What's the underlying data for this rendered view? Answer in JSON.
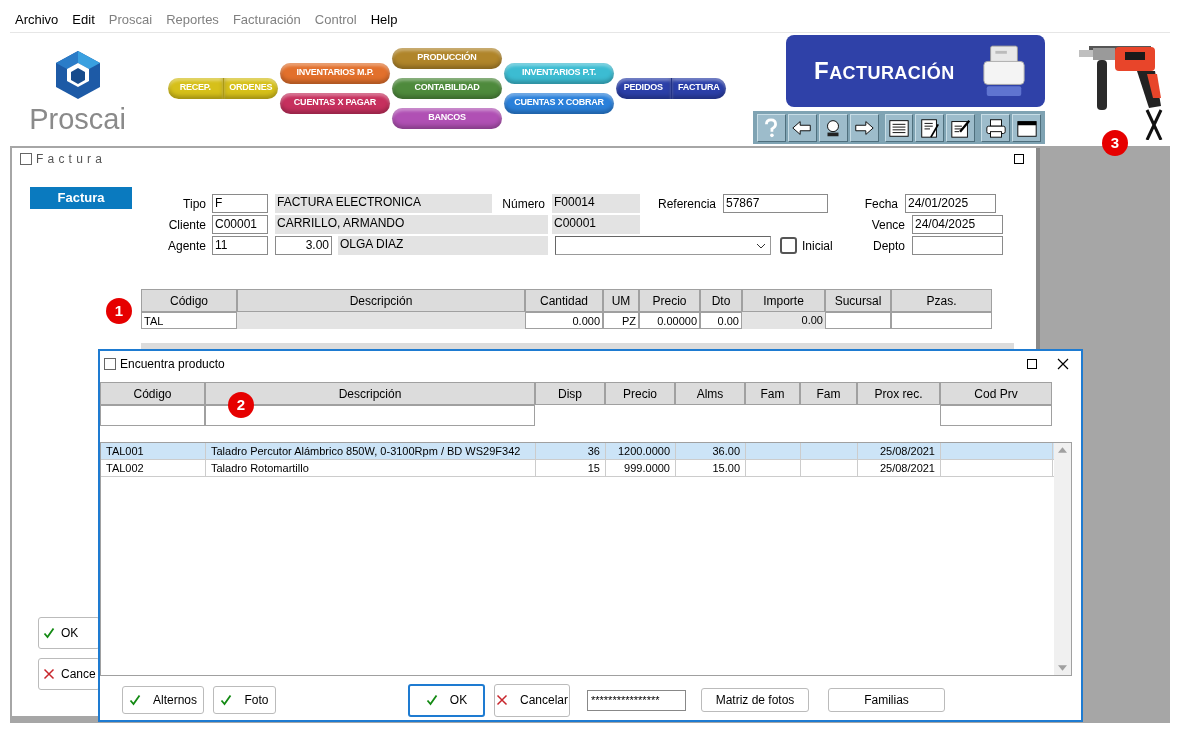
{
  "menu": [
    {
      "label": "Archivo",
      "disabled": false
    },
    {
      "label": "Edit",
      "disabled": false
    },
    {
      "label": "Proscai",
      "disabled": true
    },
    {
      "label": "Reportes",
      "disabled": true
    },
    {
      "label": "Facturación",
      "disabled": true
    },
    {
      "label": "Control",
      "disabled": true
    },
    {
      "label": "Help",
      "disabled": false
    }
  ],
  "brand": "Proscai",
  "nav_columns": [
    [
      {
        "labels": [
          "RECEP.",
          "ORDENES"
        ],
        "color": "#d6c01a"
      }
    ],
    [
      {
        "labels": [
          "INVENTARIOS M.P."
        ],
        "color": "#e2702c"
      },
      {
        "labels": [
          "CUENTAS X PAGAR"
        ],
        "color": "#c6305e"
      }
    ],
    [
      {
        "labels": [
          "PRODUCCIÓN"
        ],
        "color": "#b0852a"
      },
      {
        "labels": [
          "CONTABILIDAD"
        ],
        "color": "#4e8a3c"
      },
      {
        "labels": [
          "BANCOS"
        ],
        "color": "#b050b4"
      }
    ],
    [
      {
        "labels": [
          "INVENTARIOS P.T."
        ],
        "color": "#3cbcd2"
      },
      {
        "labels": [
          "CUENTAS X COBRAR"
        ],
        "color": "#2a80da"
      }
    ],
    [
      {
        "labels": [
          "PEDIDOS",
          "FACTURA"
        ],
        "color": "#2b3fa8"
      }
    ]
  ],
  "banner": {
    "title": "FACTURACIÓN"
  },
  "picture_badge": "3",
  "factura": {
    "title": "Factura",
    "tab": "Factura",
    "tipo": {
      "label": "Tipo",
      "code": "F",
      "name": "FACTURA ELECTRONICA"
    },
    "numero": {
      "label": "Número",
      "value": "F00014"
    },
    "referencia": {
      "label": "Referencia",
      "value": "57867"
    },
    "fecha": {
      "label": "Fecha",
      "value": "24/01/2025"
    },
    "cliente": {
      "label": "Cliente",
      "code": "C00001",
      "name": "CARRILLO, ARMANDO",
      "account": "C00001"
    },
    "vence": {
      "label": "Vence",
      "value": "24/04/2025"
    },
    "agente": {
      "label": "Agente",
      "code": "11",
      "rate": "3.00",
      "name": "OLGA DIAZ"
    },
    "inicial": {
      "label": "Inicial",
      "checked": false
    },
    "depto": {
      "label": "Depto"
    },
    "items": {
      "badge": "1",
      "columns": [
        "Código",
        "Descripción",
        "Cantidad",
        "UM",
        "Precio",
        "Dto",
        "Importe",
        "Sucursal",
        "Pzas."
      ],
      "rows": [
        {
          "codigo": "TAL",
          "cantidad": "0.000",
          "um": "PZ",
          "precio": "0.00000",
          "dto": "0.00",
          "importe": "0.00"
        }
      ]
    },
    "side_buttons": [
      {
        "kind": "check",
        "label": "OK"
      },
      {
        "kind": "cancel",
        "label": "Cance"
      }
    ]
  },
  "dialog": {
    "title": "Encuentra producto",
    "badge": "2",
    "columns": [
      "Código",
      "Descripción",
      "Disp",
      "Precio",
      "Alms",
      "Fam",
      "Fam",
      "Prox rec.",
      "Cod Prv"
    ],
    "rows": [
      {
        "selected": true,
        "codigo": "TAL001",
        "descripcion": "Taladro Percutor Alámbrico 850W, 0-3100Rpm / BD WS29F342",
        "disp": "36",
        "precio": "1200.0000",
        "alms": "36.00",
        "prox": "25/08/2021"
      },
      {
        "selected": false,
        "codigo": "TAL002",
        "descripcion": "Taladro Rotomartillo",
        "disp": "15",
        "precio": "999.0000",
        "alms": "15.00",
        "prox": "25/08/2021"
      }
    ],
    "footer_left": [
      {
        "kind": "check",
        "label": "Alternos"
      },
      {
        "kind": "check",
        "label": "Foto"
      }
    ],
    "footer_right": [
      {
        "kind": "check",
        "label": "OK",
        "focused": true
      },
      {
        "kind": "cancel",
        "label": "Cancelar",
        "focused": false
      },
      {
        "kind": "field",
        "value": "****************"
      },
      {
        "kind": "plain",
        "label": "Matriz de fotos",
        "focused": false
      },
      {
        "kind": "plain",
        "label": "Familias",
        "focused": false
      }
    ]
  }
}
